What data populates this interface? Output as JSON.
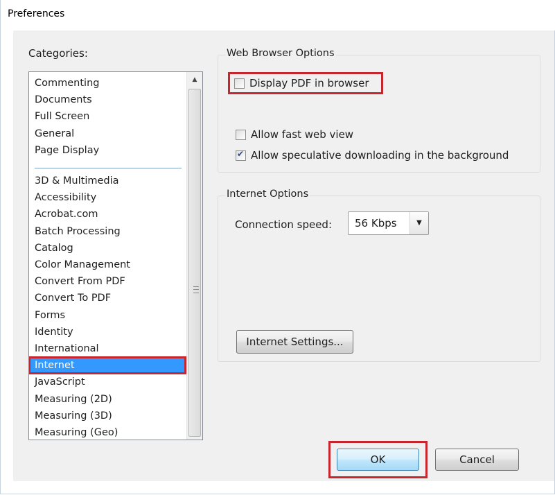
{
  "window": {
    "title": "Preferences"
  },
  "categories": {
    "label": "Categories:",
    "items": [
      "Commenting",
      "Documents",
      "Full Screen",
      "General",
      "Page Display",
      "3D & Multimedia",
      "Accessibility",
      "Acrobat.com",
      "Batch Processing",
      "Catalog",
      "Color Management",
      "Convert From PDF",
      "Convert To PDF",
      "Forms",
      "Identity",
      "International",
      "Internet",
      "JavaScript",
      "Measuring (2D)",
      "Measuring (3D)",
      "Measuring (Geo)"
    ],
    "selected": "Internet"
  },
  "web_browser_options": {
    "title": "Web Browser Options",
    "display_pdf_in_browser": {
      "label": "Display PDF in browser",
      "checked": false
    },
    "allow_fast_web_view": {
      "label": "Allow fast web view",
      "checked": false
    },
    "allow_speculative_downloading": {
      "label": "Allow speculative downloading in the background",
      "checked": true
    }
  },
  "internet_options": {
    "title": "Internet Options",
    "connection_speed_label": "Connection speed:",
    "connection_speed_value": "56 Kbps",
    "internet_settings_button": "Internet Settings..."
  },
  "footer": {
    "ok": "OK",
    "cancel": "Cancel"
  },
  "colors": {
    "highlight": "#c8262e",
    "selection": "#3399ff"
  }
}
